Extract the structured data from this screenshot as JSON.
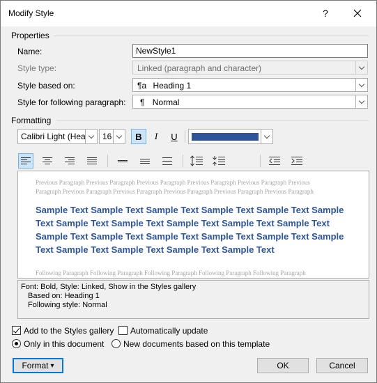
{
  "window": {
    "title": "Modify Style",
    "help_label": "?",
    "close_label": "✕"
  },
  "properties": {
    "heading": "Properties",
    "name_label": "Name:",
    "name_value": "NewStyle1",
    "style_type_label": "Style type:",
    "style_type_value": "Linked (paragraph and character)",
    "based_on_label": "Style based on:",
    "based_on_value": "Heading 1",
    "based_on_glyph": "¶a",
    "following_label": "Style for following paragraph:",
    "following_value": "Normal",
    "following_glyph": "¶"
  },
  "formatting": {
    "heading": "Formatting",
    "font_value": "Calibri Light (Heac",
    "size_value": "16",
    "bold_label": "B",
    "italic_label": "I",
    "underline_label": "U",
    "font_color": "#2e5597"
  },
  "preview": {
    "previous_paragraph": "Previous Paragraph Previous Paragraph Previous Paragraph Previous Paragraph Previous Paragraph Previous Paragraph Previous Paragraph Previous Paragraph Previous Paragraph Previous Paragraph Previous Paragraph",
    "sample_text": "Sample Text Sample Text Sample Text Sample Text Sample Text Sample Text Sample Text Sample Text Sample Text Sample Text Sample Text Sample Text Sample Text Sample Text Sample Text Sample Text Sample Text Sample Text Sample Text Sample Text Sample Text",
    "following_paragraph": "Following Paragraph Following Paragraph Following Paragraph Following Paragraph Following Paragraph"
  },
  "description": {
    "line1": "Font: Bold, Style: Linked, Show in the Styles gallery",
    "line2": "Based on: Heading 1",
    "line3": "Following style: Normal"
  },
  "options": {
    "add_gallery_label": "Add to the Styles gallery",
    "add_gallery_checked": true,
    "auto_update_label": "Automatically update",
    "auto_update_checked": false,
    "only_doc_label": "Only in this document",
    "only_doc_selected": true,
    "new_docs_label": "New documents based on this template"
  },
  "buttons": {
    "format_label": "Format",
    "format_arrow": "▾",
    "ok_label": "OK",
    "cancel_label": "Cancel"
  }
}
